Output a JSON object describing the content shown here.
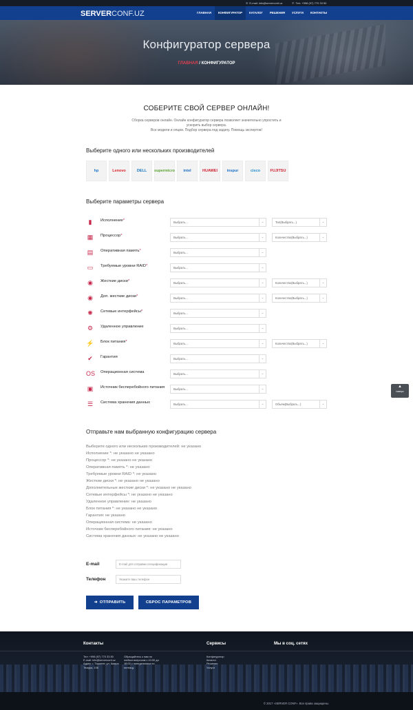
{
  "topbar": {
    "email": "E-mail: info@serverconf.uz",
    "phone": "Тел: +998 (97) 770 33 50"
  },
  "brand": {
    "logo_bold": "SERVER",
    "logo_rest": "CONF.UZ"
  },
  "nav": {
    "items": [
      "ГЛАВНАЯ",
      "КОНФИГУРАТОР",
      "КАТАЛОГ",
      "РЕШЕНИЯ",
      "УСЛУГИ",
      "КОНТАКТЫ"
    ],
    "active_index": 1
  },
  "hero": {
    "title": "Конфигуратор сервера",
    "crumb_home": "ГЛАВНАЯ",
    "crumb_sep": "/",
    "crumb_current": "КОНФИГУРАТОР"
  },
  "intro": {
    "title": "СОБЕРИТЕ СВОЙ СЕРВЕР ОНЛАЙН!",
    "text": "Сборка серверов онлайн. Онлайн конфигуратор сервера позволяет значительно упростить и ускорить выбор сервера.\nВсе модели и опции. Подбор сервера под задачу. Помощь экспертов!"
  },
  "vendors": {
    "title": "Выберите одного или нескольких производителей",
    "items": [
      {
        "name": "hp",
        "icon": "hp-logo-icon",
        "color": "#1d76c8"
      },
      {
        "name": "Lenovo",
        "icon": "lenovo-logo-icon",
        "color": "#d8232a"
      },
      {
        "name": "DELL",
        "icon": "dell-logo-icon",
        "color": "#1879c4"
      },
      {
        "name": "supermicro",
        "icon": "supermicro-logo-icon",
        "color": "#5aa333"
      },
      {
        "name": "intel",
        "icon": "intel-logo-icon",
        "color": "#1a6fc7"
      },
      {
        "name": "HUAWEI",
        "icon": "huawei-logo-icon",
        "color": "#cf2232"
      },
      {
        "name": "inspur",
        "icon": "inspur-logo-icon",
        "color": "#1a6fc7"
      },
      {
        "name": "cisco",
        "icon": "cisco-logo-icon",
        "color": "#1d8cd0"
      },
      {
        "name": "FUJITSU",
        "icon": "fujitsu-logo-icon",
        "color": "#cf2232"
      }
    ]
  },
  "params": {
    "title": "Выберите параметры сервера",
    "rows": [
      {
        "label": "Исполнение",
        "req": "*",
        "icon": "server-case-icon",
        "glyph": "▮",
        "main": "Выбрать...",
        "extra": "Тип(Выбрать...)"
      },
      {
        "label": "Процессор",
        "req": "*",
        "icon": "cpu-icon",
        "glyph": "▦",
        "main": "Выбрать...",
        "extra": "Количество(Выбрать...)"
      },
      {
        "label": "Оперативная память",
        "req": "*",
        "icon": "ram-icon",
        "glyph": "▤",
        "main": "Выбрать...",
        "extra": ""
      },
      {
        "label": "Требуемые уровни RAID",
        "req": "*",
        "icon": "raid-icon",
        "glyph": "▭",
        "main": "Выбрать...",
        "extra": ""
      },
      {
        "label": "Жесткие диски",
        "req": "*",
        "icon": "hdd-icon",
        "glyph": "◉",
        "main": "Выбрать...",
        "extra": "Количество(Выбрать...)"
      },
      {
        "label": "Доп. жесткие диски",
        "req": "*",
        "icon": "hdd-extra-icon",
        "glyph": "◉",
        "main": "Выбрать...",
        "extra": "Количество(Выбрать...)"
      },
      {
        "label": "Сетевые интерфейсы",
        "req": "*",
        "icon": "network-icon",
        "glyph": "✺",
        "main": "Выбрать...",
        "extra": ""
      },
      {
        "label": "Удаленное управление",
        "req": "",
        "icon": "remote-control-icon",
        "glyph": "⚙",
        "main": "Выбрать...",
        "extra": ""
      },
      {
        "label": "Блок питания",
        "req": "*",
        "icon": "power-icon",
        "glyph": "⚡",
        "main": "Выбрать...",
        "extra": "Количество(Выбрать...)"
      },
      {
        "label": "Гарантия",
        "req": "",
        "icon": "warranty-icon",
        "glyph": "✔",
        "main": "Выбрать...",
        "extra": ""
      },
      {
        "label": "Операционная система",
        "req": "",
        "icon": "os-icon",
        "glyph": "OS",
        "main": "Выбрать...",
        "extra": ""
      },
      {
        "label": "Источник бесперебойного питания",
        "req": "",
        "icon": "ups-icon",
        "glyph": "▣",
        "main": "Выбрать...",
        "extra": ""
      },
      {
        "label": "Система хранения данных",
        "req": "",
        "icon": "storage-icon",
        "glyph": "☰",
        "main": "Выбрать...",
        "extra": "Объём(Выбрать...)"
      }
    ]
  },
  "summary": {
    "title": "Отправьте нам выбранную конфигурацию сервера",
    "lines": [
      "Выберите одного или нескольких производителей: не указано",
      "Исполнение *: не указано не указано",
      "Процессор *: не указано не указано",
      "Оперативная память *: не указано",
      "Требуемые уровни RAID *: не указано",
      "Жесткие диски *: не указано не указано",
      "Дополнительные жесткие диски *: не указано не указано",
      "Сетевые интерфейсы *: не указано не указано",
      "Удаленное управление: не указано",
      "Блок питания *: не указано не указано",
      "Гарантия: не указано",
      "Операционная система: не указано",
      "Источник бесперебойного питания: не указано",
      "Система хранения данных: не указано не указано"
    ]
  },
  "form": {
    "email_label": "E-mail",
    "email_placeholder": "E-mail для отправки спецификации",
    "phone_label": "Телефон",
    "phone_placeholder": "Укажите ваш телефон",
    "send_label": "ОТПРАВИТЬ",
    "reset_label": "СБРОС ПАРАМЕТРОВ"
  },
  "side_button": {
    "label": "наверх"
  },
  "footer": {
    "contacts_title": "Контакты",
    "contacts_lines": [
      "Тел: +998 (97) 770 33 50",
      "E-mail: info@serverconf.uz",
      "Адрес: г. Ташкент, ул. Амира",
      "Темура, 106"
    ],
    "note_lines": [
      "Обращайтесь к нам по",
      "любым вопросам с 10:00 до",
      "18:00 с понедельника по",
      "пятницу"
    ],
    "services_title": "Сервисы",
    "services": [
      "Конфигуратор",
      "Каталог",
      "Решения",
      "Услуги"
    ],
    "social_title": "Мы в соц. сетях",
    "copyright": "© 2017 «SERVER CONF». Все права защищены."
  },
  "colors": {
    "brand_blue": "#123f8e",
    "accent_red": "#c8284c",
    "footer_bg": "#10161f"
  }
}
